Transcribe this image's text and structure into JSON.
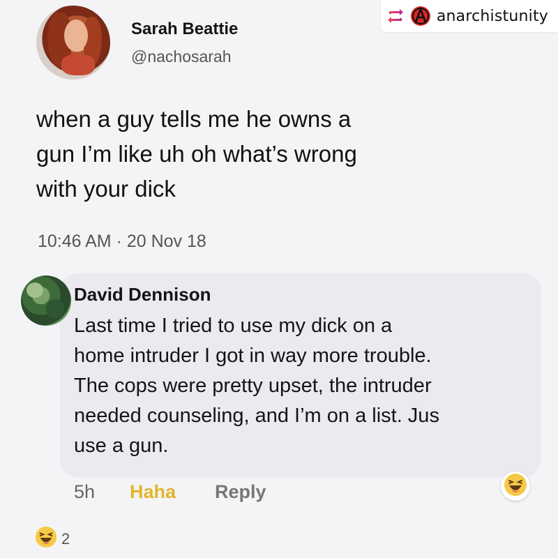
{
  "repost": {
    "handle": "anarchistunity",
    "icons": [
      "repost-icon",
      "anarchy-icon"
    ],
    "repost_color": "#e1306c"
  },
  "tweet": {
    "author_name": "Sarah Beattie",
    "author_handle": "@nachosarah",
    "text": "when a guy tells me he owns a\ngun I’m like uh oh what’s wrong\nwith your dick",
    "timestamp": "10:46 AM · 20 Nov 18"
  },
  "comment": {
    "author_name": "David Dennison",
    "text": "Last time I tried to use my dick on a\nhome intruder I got in way more trouble.\nThe cops were pretty upset, the intruder\nneeded counseling, and I’m on a list. Jus\nuse a gun.",
    "time_ago": "5h",
    "haha_label": "Haha",
    "reply_label": "Reply",
    "reaction_icon": "laughing-emoji-icon"
  },
  "reactions": {
    "icon": "laughing-emoji-icon",
    "count": "2"
  },
  "colors": {
    "haha": "#e2b52a",
    "bubble": "#eaeaef",
    "background": "#f4f4f6"
  }
}
